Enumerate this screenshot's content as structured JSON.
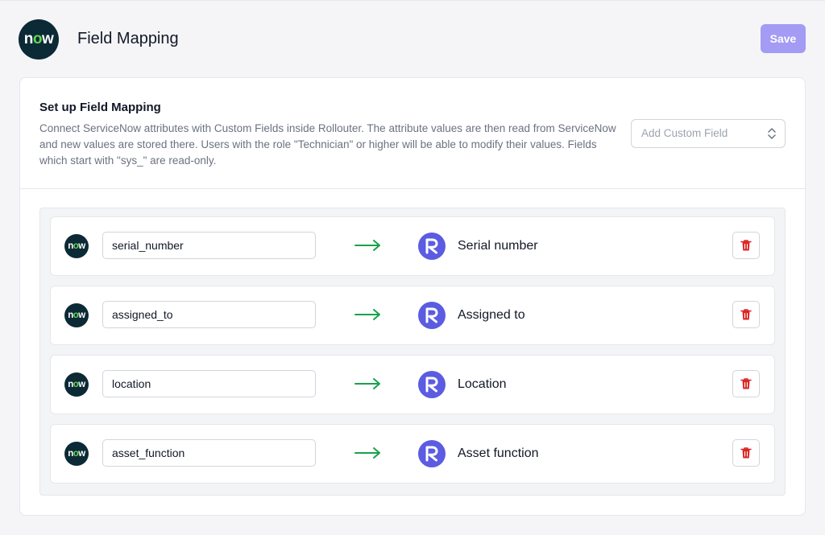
{
  "header": {
    "logo_text": "now",
    "title": "Field Mapping",
    "save_label": "Save"
  },
  "setup": {
    "title": "Set up Field Mapping",
    "description": "Connect ServiceNow attributes with Custom Fields inside Rollouter. The attribute values are then read from ServiceNow and new values are stored there. Users with the role \"Technician\" or higher will be able to modify their values. Fields which start with \"sys_\" are read-only.",
    "custom_field_placeholder": "Add Custom Field"
  },
  "mappings": [
    {
      "attribute": "serial_number",
      "custom_field": "Serial number"
    },
    {
      "attribute": "assigned_to",
      "custom_field": "Assigned to"
    },
    {
      "attribute": "location",
      "custom_field": "Location"
    },
    {
      "attribute": "asset_function",
      "custom_field": "Asset function"
    }
  ],
  "colors": {
    "accent": "#a39bf4",
    "brand_rollouter": "#5b5ce2",
    "arrow": "#16a34a",
    "delete": "#dc2626",
    "now_bg": "#0b2a36",
    "now_o": "#62d84e"
  },
  "icons": {
    "servicenow": "servicenow-logo-icon",
    "rollouter": "rollouter-logo-icon",
    "arrow": "arrow-right-icon",
    "delete": "trash-icon",
    "select": "chevron-up-down-icon"
  }
}
